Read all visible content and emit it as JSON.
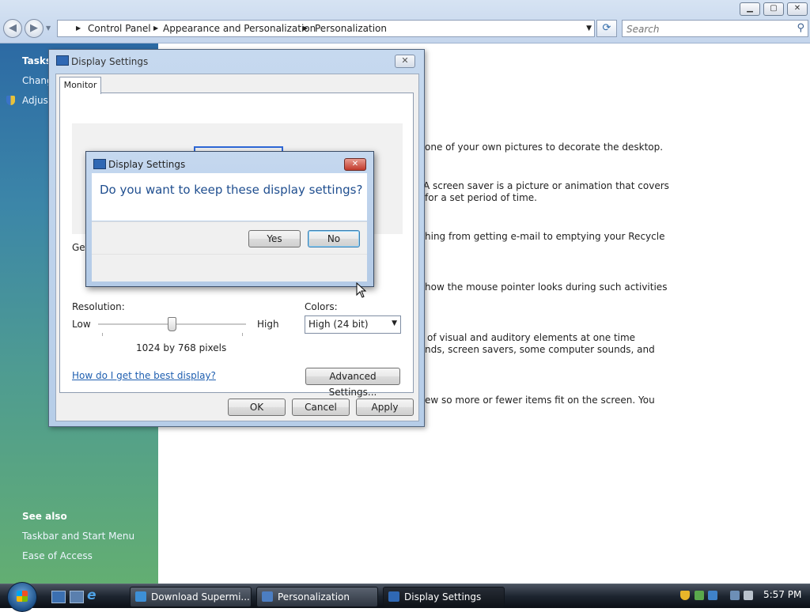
{
  "window": {
    "controls": {
      "minimize": "▁",
      "maximize": "▢",
      "close": "✕"
    },
    "breadcrumb": [
      "Control Panel",
      "Appearance and Personalization",
      "Personalization"
    ],
    "search_placeholder": "Search"
  },
  "left_pane": {
    "tasks_heading": "Tasks",
    "tasks": [
      "Chang",
      "Adjust"
    ],
    "see_also_heading": "See also",
    "see_also": [
      "Taskbar and Start Menu",
      "Ease of Access"
    ]
  },
  "background_text": [
    "one of your own pictures to decorate the desktop.",
    "A screen saver is a picture or animation that covers",
    "for a set period of time.",
    "hing from getting e-mail to emptying your Recycle",
    "how the mouse pointer looks during such activities",
    "of visual and auditory elements at one time",
    "nds, screen savers, some computer sounds, and",
    "ew so more or fewer items fit on the screen. You"
  ],
  "display_settings": {
    "title": "Display Settings",
    "tab": "Monitor",
    "general_label_partial": "Ger",
    "resolution_label": "Resolution:",
    "low_label": "Low",
    "high_label": "High",
    "resolution_value": "1024 by 768 pixels",
    "resolution_slider_position": 0.5,
    "colors_label": "Colors:",
    "colors_value": "High (24 bit)",
    "help_link": "How do I get the best display?",
    "advanced_button": "Advanced Settings...",
    "ok_button": "OK",
    "cancel_button": "Cancel",
    "apply_button": "Apply"
  },
  "confirm_dialog": {
    "title": "Display Settings",
    "question": "Do you want to keep these display settings?",
    "yes_button": "Yes",
    "no_button": "No"
  },
  "taskbar": {
    "buttons": [
      "Download Supermi...",
      "Personalization",
      "Display Settings"
    ],
    "active_index": 2,
    "clock": "5:57 PM"
  },
  "colors": {
    "accent_blue": "#1f4e8f",
    "link_blue": "#1f5fb0"
  }
}
